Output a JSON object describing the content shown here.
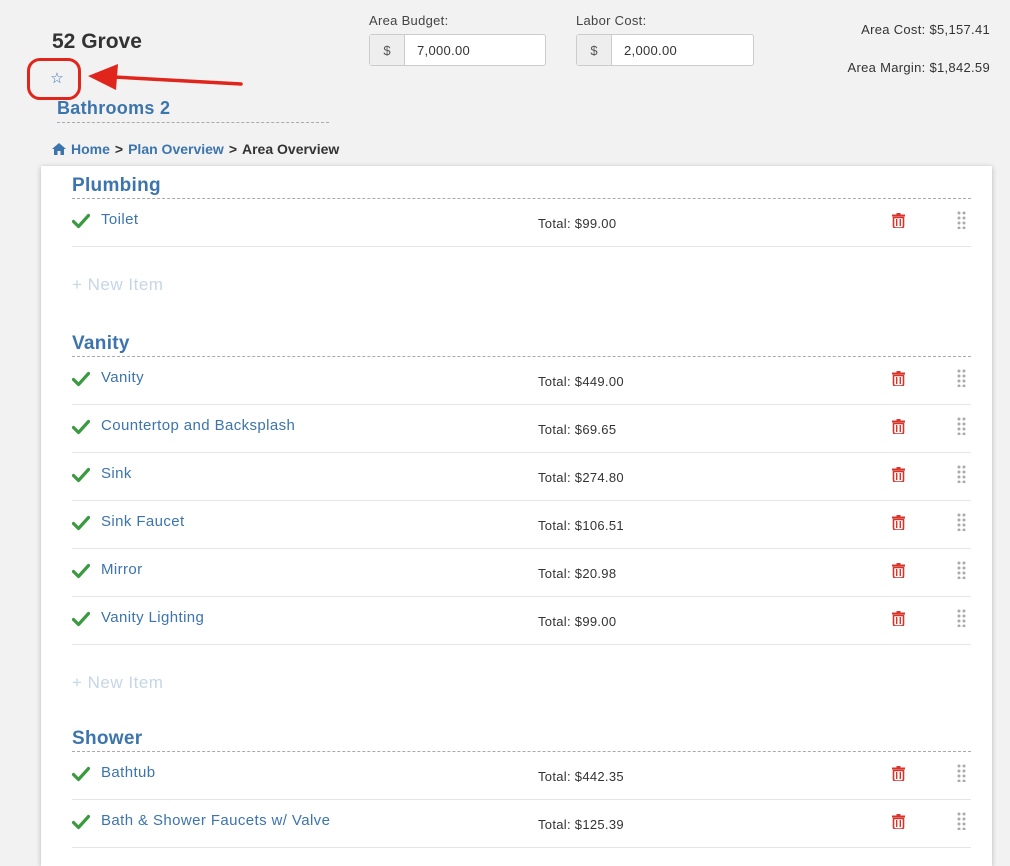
{
  "header": {
    "project_title": "52 Grove",
    "area_name": "Bathrooms 2",
    "breadcrumb": {
      "home": "Home",
      "sep1": ">",
      "plan": "Plan Overview",
      "sep2": ">",
      "current": "Area Overview"
    },
    "area_budget": {
      "label": "Area Budget:",
      "prefix": "$",
      "value": "7,000.00"
    },
    "labor_cost": {
      "label": "Labor Cost:",
      "prefix": "$",
      "value": "2,000.00"
    },
    "area_cost": "Area Cost: $5,157.41",
    "area_margin": "Area Margin: $1,842.59",
    "star_glyph": "☆"
  },
  "icons": {
    "star": "star-icon",
    "home": "home-icon",
    "check": "check-icon",
    "trash": "trash-icon",
    "drag": "drag-handle-icon"
  },
  "colors": {
    "accent": "#3c74ad",
    "check": "#3a9a3f",
    "trash": "#d9342b",
    "annotation": "#e0261c",
    "new_item": "#c5d6e8"
  },
  "sections": [
    {
      "title": "Plumbing",
      "items": [
        {
          "name": "Toilet",
          "total": "Total: $99.00"
        }
      ],
      "new_item": "+ New Item"
    },
    {
      "title": "Vanity",
      "items": [
        {
          "name": "Vanity",
          "total": "Total: $449.00"
        },
        {
          "name": "Countertop and Backsplash",
          "total": "Total: $69.65"
        },
        {
          "name": "Sink",
          "total": "Total: $274.80"
        },
        {
          "name": "Sink Faucet",
          "total": "Total: $106.51"
        },
        {
          "name": "Mirror",
          "total": "Total: $20.98"
        },
        {
          "name": "Vanity Lighting",
          "total": "Total: $99.00"
        }
      ],
      "new_item": "+ New Item"
    },
    {
      "title": "Shower",
      "items": [
        {
          "name": "Bathtub",
          "total": "Total: $442.35"
        },
        {
          "name": "Bath & Shower Faucets w/ Valve",
          "total": "Total: $125.39"
        }
      ]
    }
  ]
}
